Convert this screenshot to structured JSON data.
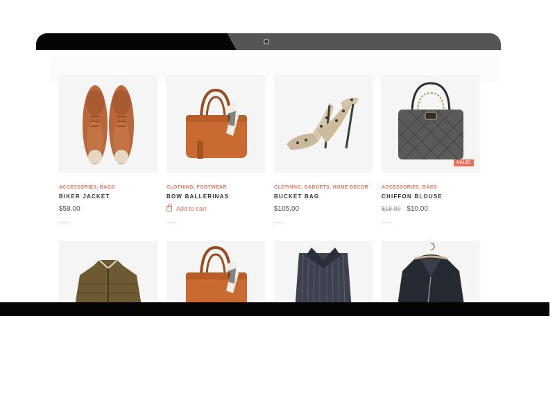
{
  "products": [
    {
      "categories": "ACCESSORIES, BAGS",
      "title": "BIKER JACKET",
      "price": "$58.00"
    },
    {
      "categories": "CLOTHING, FOOTWEAR",
      "title": "BOW BALLERINAS",
      "action": "Add to cart"
    },
    {
      "categories": "CLOTHING, GADGETS, HOME DECOR",
      "title": "BUCKET BAG",
      "price": "$105.00"
    },
    {
      "categories": "ACCESSORIES, BAGS",
      "title": "CHIFFON BLOUSE",
      "old_price": "$18.00",
      "price": "$10.00",
      "badge": "SALE!"
    }
  ],
  "colors": {
    "accent": "#e8705a",
    "bezel": "#050505",
    "bezel_gray": "#555555",
    "thumb_bg": "#f5f5f5"
  },
  "icons": [
    "camera-icon",
    "shopping-bag-icon"
  ]
}
